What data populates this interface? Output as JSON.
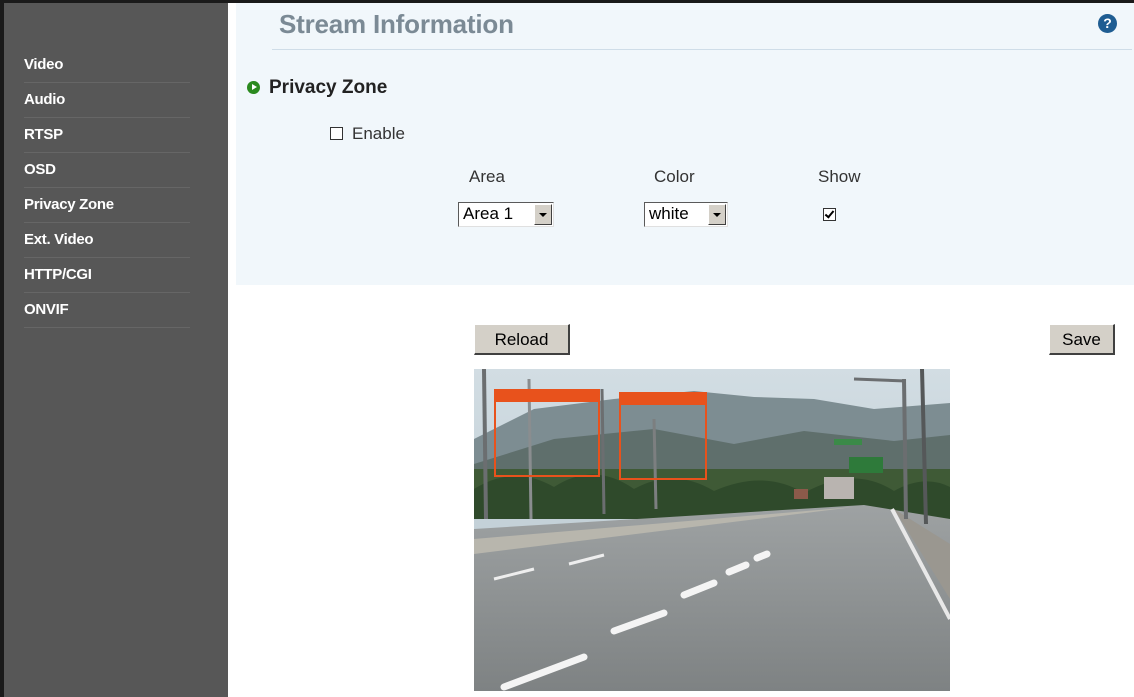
{
  "sidebar": {
    "items": [
      {
        "label": "Video"
      },
      {
        "label": "Audio"
      },
      {
        "label": "RTSP"
      },
      {
        "label": "OSD"
      },
      {
        "label": "Privacy Zone"
      },
      {
        "label": "Ext. Video"
      },
      {
        "label": "HTTP/CGI"
      },
      {
        "label": "ONVIF"
      }
    ]
  },
  "header": {
    "title": "Stream Information",
    "help_icon_glyph": "?"
  },
  "privacy_zone": {
    "section_title": "Privacy Zone",
    "enable": {
      "label": "Enable",
      "checked": false
    },
    "columns": {
      "area": "Area",
      "color": "Color",
      "show": "Show"
    },
    "area_select": {
      "value": "Area 1"
    },
    "color_select": {
      "value": "white"
    },
    "show_checkbox": {
      "checked": true
    }
  },
  "actions": {
    "reload_label": "Reload",
    "save_label": "Save"
  },
  "preview": {
    "zone_color": "#e8521c"
  },
  "colors": {
    "sidebar_bg": "#575757",
    "panel_bg": "#f1f7fb",
    "title_color": "#7b8a95",
    "accent_green": "#2b8a1f",
    "help_blue": "#1f5d92"
  }
}
